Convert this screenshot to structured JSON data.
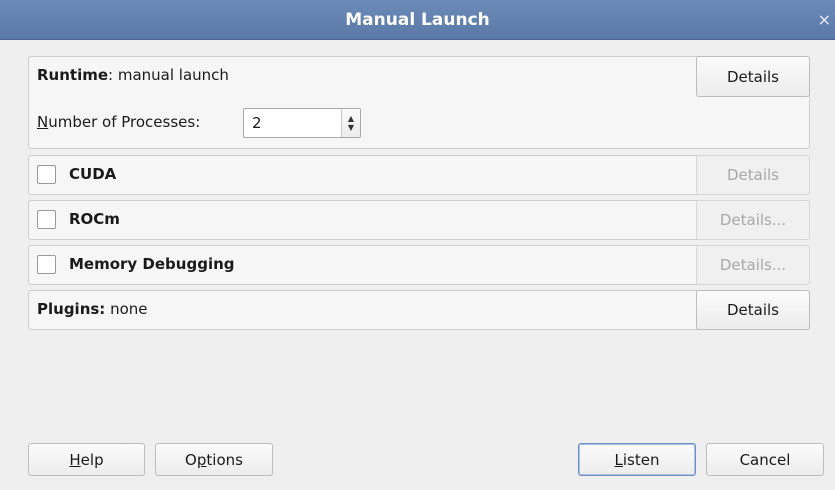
{
  "window": {
    "title": "Manual Launch",
    "close_glyph": "×"
  },
  "runtime": {
    "label_bold": "Runtime",
    "label_rest": ": manual launch",
    "details_button": "Details",
    "processes": {
      "label_underlined": "N",
      "label_rest": "umber of Processes:",
      "value": "2"
    }
  },
  "cuda": {
    "label": "CUDA",
    "checked": false,
    "details_button": "Details"
  },
  "rocm": {
    "label": "ROCm",
    "checked": false,
    "details_button": "Details..."
  },
  "memory_debugging": {
    "label": "Memory Debugging",
    "checked": false,
    "details_button": "Details..."
  },
  "plugins": {
    "label_bold": "Plugins:",
    "label_rest": " none",
    "details_button": "Details"
  },
  "footer": {
    "help": {
      "underlined": "H",
      "rest": "elp"
    },
    "options": {
      "before": "O",
      "underlined": "p",
      "rest": "tions"
    },
    "listen": {
      "underlined": "L",
      "rest": "isten"
    },
    "cancel": "Cancel"
  },
  "colors": {
    "titlebar": "#5f7eab",
    "disabled_text": "#a8a8a8",
    "default_border": "#6f90c4"
  }
}
